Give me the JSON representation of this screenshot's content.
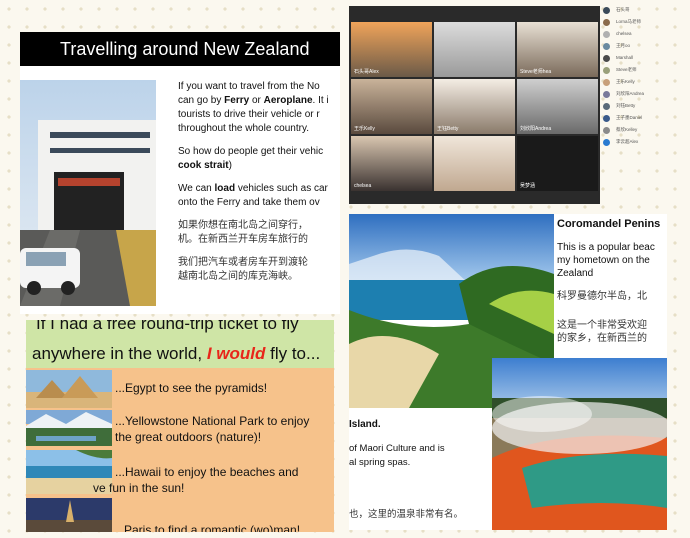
{
  "slide1": {
    "title": "Travelling around New Zealand",
    "p1_a": "If you want to travel from the No",
    "p1_b_pre": "can go by ",
    "p1_b_ferry": "Ferry",
    "p1_b_or": " or ",
    "p1_b_aero": "Aeroplane",
    "p1_b_post": ". It i",
    "p1_c": "tourists to drive their vehicle or r",
    "p1_d": "throughout the whole country.",
    "p2_a": "So how do people get their vehic",
    "p2_b": "cook strait",
    "p2_b_post": ")",
    "p3_a_pre": "We can ",
    "p3_a_bold": "load",
    "p3_a_post": " vehicles such as car",
    "p3_b": "onto the Ferry and take them ov",
    "cn1": "如果你想在南北岛之间穿行，",
    "cn2": "机。在新西兰开车房车旅行的",
    "cn3": "我们把汽车或者房车开到渡轮",
    "cn4": "越南北岛之间的库克海峡。"
  },
  "slide2": {
    "line1_a": "If I had a free round-trip ticket to fly",
    "line2_a": "anywhere in the world, ",
    "line2_red": "I would",
    "line2_b": " fly to...",
    "item1": "...Egypt to see the pyramids!",
    "item2_a": "...Yellowstone National Park to enjoy",
    "item2_b": "the great outdoors (nature)!",
    "item3_a": "...Hawaii to enjoy the beaches and",
    "item3_b": "ve fun in the sun!",
    "item4": "Paris to find a romantic (wo)man!"
  },
  "video": {
    "tiles": [
      {
        "name": "石头哥Alex"
      },
      {
        "name": ""
      },
      {
        "name": "Steve老师hea"
      },
      {
        "name": "王乐Kelly"
      },
      {
        "name": "王钰Betty"
      },
      {
        "name": "刘欣阳Andrea"
      },
      {
        "name": "chelsea"
      },
      {
        "name": ""
      },
      {
        "name": "吴梦涵"
      }
    ]
  },
  "participants": [
    {
      "name": "石头哥"
    },
    {
      "name": "Lorna马老师"
    },
    {
      "name": "chelsea"
    },
    {
      "name": "王月oo"
    },
    {
      "name": "Marshall"
    },
    {
      "name": "Steve老师"
    },
    {
      "name": "王乐Kelly"
    },
    {
      "name": "刘欣阳Andrea"
    },
    {
      "name": "刘钰Betty"
    },
    {
      "name": "王子墨Daniel"
    },
    {
      "name": "蔡欣Kelley"
    },
    {
      "name": "李云超Alex"
    }
  ],
  "slide3": {
    "heading": "Coromandel Penins",
    "en1": "This is a popular beac",
    "en2": "my hometown on the",
    "en3": "Zealand",
    "cn1": "科罗曼德尔半岛，北",
    "cn2": "这是一个非常受欢迎",
    "cn3": "的家乡，在新西兰的",
    "island": "Island.",
    "maori": "of Maori Culture and is",
    "spas": "al spring spas.",
    "cn_bottom": "也，这里的温泉非常有名。"
  },
  "colors": {
    "title_bar": "#000000",
    "slide2_top": "#cfe5a6",
    "slide2_body": "#f6c28b",
    "emphasis_red": "#e8261a"
  }
}
